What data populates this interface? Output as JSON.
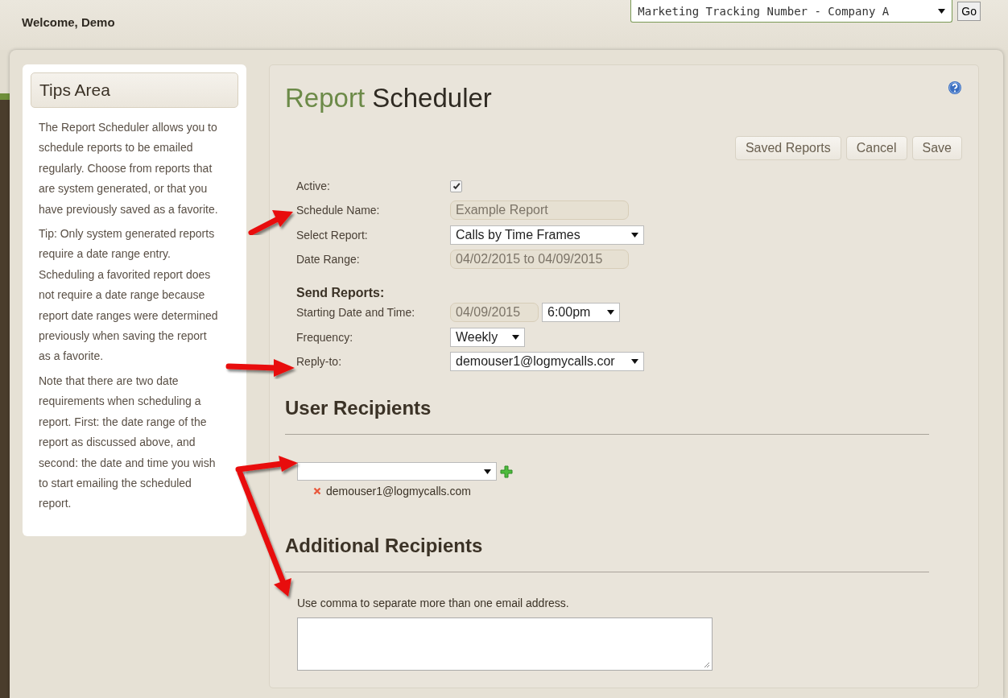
{
  "header": {
    "welcome": "Welcome, Demo",
    "tracker_select": {
      "value": "Marketing Tracking Number - Company A"
    },
    "go_button": "Go"
  },
  "tips": {
    "title": "Tips Area",
    "paragraphs": [
      "The Report Scheduler allows you to schedule reports to be emailed regularly. Choose from reports that are system generated, or that you have previously saved as a favorite.",
      "Tip: Only system generated reports require a date range entry. Scheduling a favorited report does not require a date range because report date ranges were determined previously when saving the report as a favorite.",
      "Note that there are two date requirements when scheduling a report. First: the date range of the report as discussed above, and second: the date and time you wish to start emailing the scheduled report."
    ]
  },
  "scheduler": {
    "title_accent": "Report",
    "title": "Scheduler",
    "buttons": [
      "Saved Reports",
      "Cancel",
      "Save"
    ],
    "fields": [
      {
        "kind": "checkbox",
        "label": "Active:",
        "checked": true
      },
      {
        "kind": "input",
        "label": "Schedule Name:",
        "value": "Example Report",
        "disabled": true
      },
      {
        "kind": "select",
        "label": "Select Report:",
        "value": "Calls by Time Frames"
      },
      {
        "kind": "input",
        "label": "Date Range:",
        "value": "04/02/2015 to 04/09/2015",
        "disabled": true
      },
      {
        "kind": "heading",
        "label": "Send Reports:"
      },
      {
        "kind": "datetime",
        "label": "Starting Date and Time:",
        "date": "04/09/2015",
        "time": "6:00pm"
      },
      {
        "kind": "small-select",
        "label": "Frequency:",
        "value": "Weekly"
      },
      {
        "kind": "select",
        "label": "Reply-to:",
        "value": "demouser1@logmycalls.cor"
      }
    ]
  },
  "user_recipients": {
    "heading": "User Recipients",
    "recipients": [
      "demouser1@logmycalls.com"
    ]
  },
  "additional_recipients": {
    "heading": "Additional Recipients",
    "hint": "Use comma to separate more than one email address."
  }
}
